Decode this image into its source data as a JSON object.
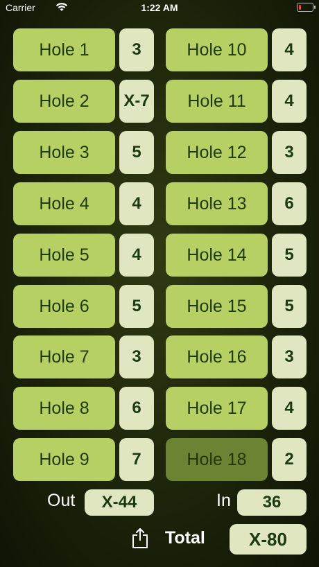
{
  "status": {
    "carrier": "Carrier",
    "time": "1:22 AM",
    "battery_color": "#ff3b30"
  },
  "holes": [
    {
      "label": "Hole 1",
      "score": "3"
    },
    {
      "label": "Hole 2",
      "score": "X-7"
    },
    {
      "label": "Hole 3",
      "score": "5"
    },
    {
      "label": "Hole 4",
      "score": "4"
    },
    {
      "label": "Hole 5",
      "score": "4"
    },
    {
      "label": "Hole 6",
      "score": "5"
    },
    {
      "label": "Hole 7",
      "score": "3"
    },
    {
      "label": "Hole 8",
      "score": "6"
    },
    {
      "label": "Hole 9",
      "score": "7"
    },
    {
      "label": "Hole 10",
      "score": "4"
    },
    {
      "label": "Hole 11",
      "score": "4"
    },
    {
      "label": "Hole 12",
      "score": "3"
    },
    {
      "label": "Hole 13",
      "score": "6"
    },
    {
      "label": "Hole 14",
      "score": "5"
    },
    {
      "label": "Hole 15",
      "score": "5"
    },
    {
      "label": "Hole 16",
      "score": "3"
    },
    {
      "label": "Hole 17",
      "score": "4"
    },
    {
      "label": "Hole 18",
      "score": "2"
    }
  ],
  "totals": {
    "out_label": "Out",
    "out_value": "X-44",
    "in_label": "In",
    "in_value": "36",
    "total_label": "Total",
    "total_value": "X-80"
  },
  "colors": {
    "hole_button": "#b6d064",
    "hole_button_selected": "#6b8433",
    "score_box": "#dfe6c0",
    "score_text": "#1b3a0f"
  },
  "icons": {
    "share": "share-icon",
    "wifi": "wifi-icon",
    "battery": "battery-icon"
  }
}
